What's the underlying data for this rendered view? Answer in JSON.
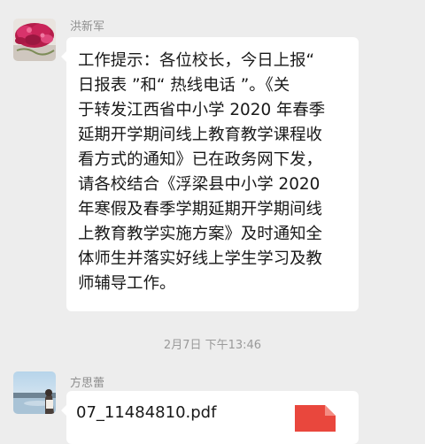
{
  "messages": [
    {
      "sender": "洪新军",
      "avatar_icon": "rose-photo-avatar",
      "text_lines": [
        "工作提示：各位校长，今日上报“",
        "日报表 ”和“ 热线电话 ”。《关",
        "于转发江西省中小学 2020 年春季",
        "延期开学期间线上教育教学课程收",
        "看方式的通知》已在政务网下发，",
        "请各校结合《浮梁县中小学 2020",
        "年寒假及春季学期延期开学期间线",
        "上教育教学实施方案》及时通知全",
        "体师生并落实好线上学生学习及教",
        "师辅导工作。"
      ]
    },
    {
      "sender": "方思蕾",
      "avatar_icon": "lake-photo-avatar",
      "file_name": "07_11484810.pdf",
      "file_icon": "pdf-file-icon"
    }
  ],
  "timestamp": "2月7日 下午13:46",
  "colors": {
    "background": "#ededed",
    "bubble": "#ffffff",
    "pdf_icon": "#e9473d"
  }
}
